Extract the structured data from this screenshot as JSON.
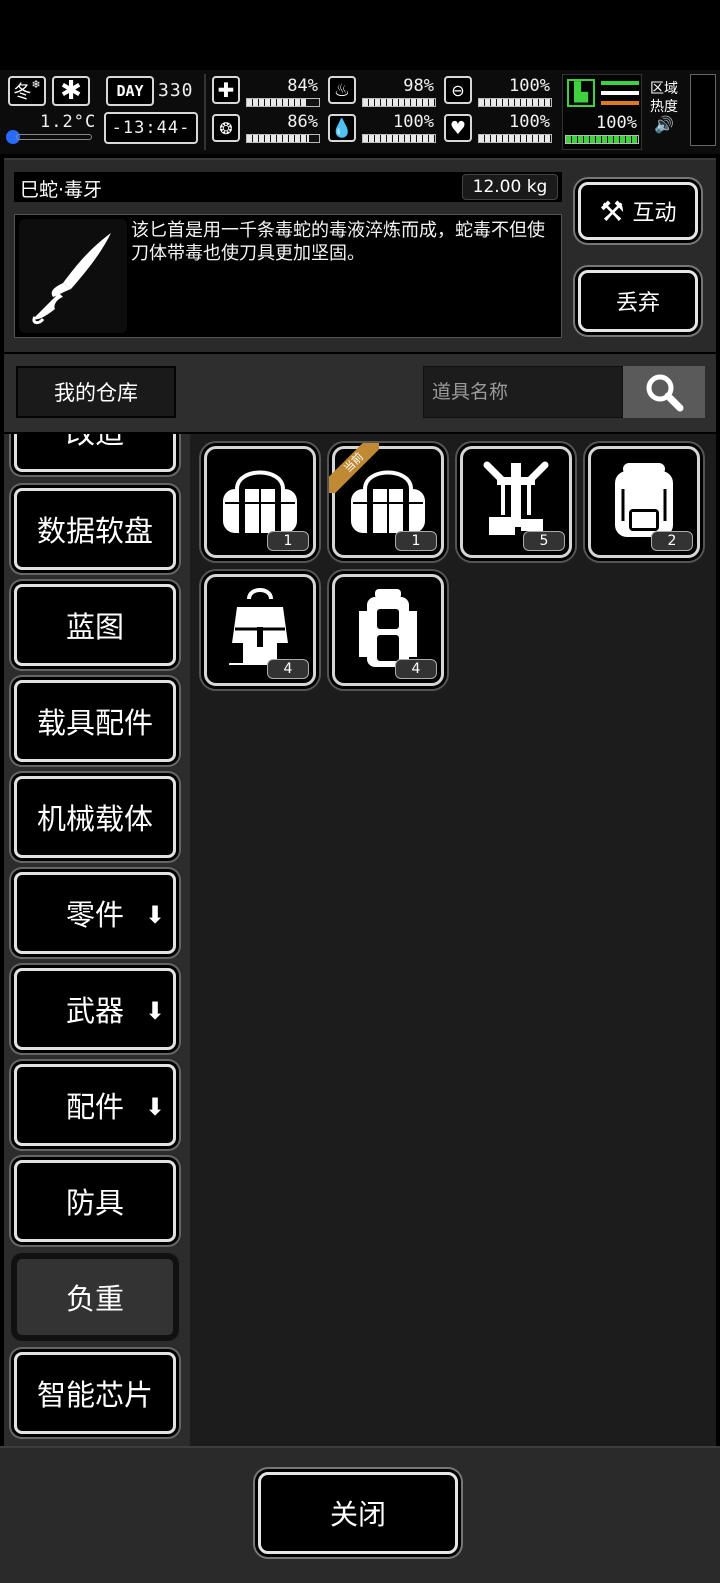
{
  "hud": {
    "season": "冬",
    "day_label": "DAY",
    "day": "330",
    "temperature": "1.2°C",
    "time": "-13:44-",
    "stats": {
      "health": 84,
      "hunger": 98,
      "energy": 100,
      "mental": 86,
      "thirst": 100,
      "mood": 100,
      "stamina": 100
    },
    "labels": {
      "health": "84%",
      "hunger": "98%",
      "energy": "100%",
      "mental": "86%",
      "thirst": "100%",
      "mood": "100%",
      "stamina": "100%"
    },
    "zone_line1": "区域",
    "zone_line2": "热度"
  },
  "item": {
    "name": "巳蛇·毒牙",
    "weight": "12.00 kg",
    "description": "该匕首是用一千条毒蛇的毒液淬炼而成，蛇毒不但使刀体带毒也使刀具更加坚固。"
  },
  "actions": {
    "interact": "互动",
    "discard": "丢弃",
    "close": "关闭"
  },
  "search": {
    "storage": "我的仓库",
    "placeholder": "道具名称"
  },
  "categories": [
    {
      "label": "改造"
    },
    {
      "label": "数据软盘"
    },
    {
      "label": "蓝图"
    },
    {
      "label": "载具配件"
    },
    {
      "label": "机械载体"
    },
    {
      "label": "零件",
      "expandable": true
    },
    {
      "label": "武器",
      "expandable": true
    },
    {
      "label": "配件",
      "expandable": true
    },
    {
      "label": "防具"
    },
    {
      "label": "负重",
      "active": true
    },
    {
      "label": "智能芯片"
    }
  ],
  "items": [
    {
      "icon": "duffel-bag-icon",
      "count": "1"
    },
    {
      "icon": "duffel-bag-icon",
      "count": "1",
      "badge": "当前"
    },
    {
      "icon": "exoskeleton-icon",
      "count": "5"
    },
    {
      "icon": "backpack-icon",
      "count": "2"
    },
    {
      "icon": "rucksack-icon",
      "count": "4"
    },
    {
      "icon": "hiking-pack-icon",
      "count": "4"
    }
  ],
  "colors": {
    "stamina": "#3fd23f",
    "heat_orange": "#e07a20",
    "badge": "#c08a34"
  }
}
